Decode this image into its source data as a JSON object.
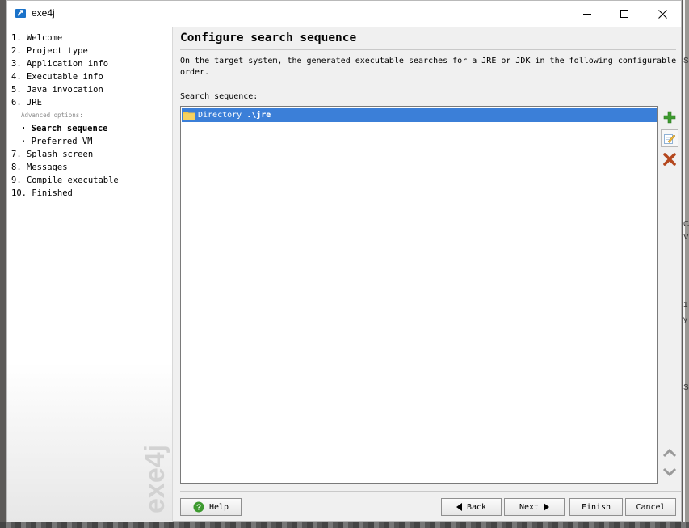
{
  "window": {
    "title": "exe4j"
  },
  "titlebar_buttons": {
    "minimize": "─",
    "maximize": "☐",
    "close": "✕"
  },
  "steps": [
    "1. Welcome",
    "2. Project type",
    "3. Application info",
    "4. Executable info",
    "5. Java invocation",
    "6. JRE"
  ],
  "advanced_label": "Advanced options:",
  "substeps": [
    "· Search sequence",
    "· Preferred VM"
  ],
  "steps_after": [
    "7. Splash screen",
    "8. Messages",
    "9. Compile executable",
    "10. Finished"
  ],
  "watermark": "exe4j",
  "page": {
    "title": "Configure search sequence",
    "description": "On the target system, the generated executable searches for a JRE or JDK in the following configurable order.",
    "list_label": "Search sequence:"
  },
  "sequence": [
    {
      "type": "Directory",
      "path": ".\\jre"
    }
  ],
  "icons": {
    "add": "add-icon",
    "edit": "edit-icon",
    "remove": "remove-icon",
    "up": "move-up-icon",
    "down": "move-down-icon",
    "help": "help-icon"
  },
  "buttons": {
    "help": "Help",
    "back": "Back",
    "next": "Next",
    "finish": "Finish",
    "cancel": "Cancel"
  },
  "colors": {
    "selection": "#3b7fd8",
    "add": "#3d9a2f",
    "remove": "#b4471d"
  },
  "desktop": {
    "edge_letters": [
      "S",
      "C",
      "V",
      "1",
      "y",
      "S"
    ]
  }
}
